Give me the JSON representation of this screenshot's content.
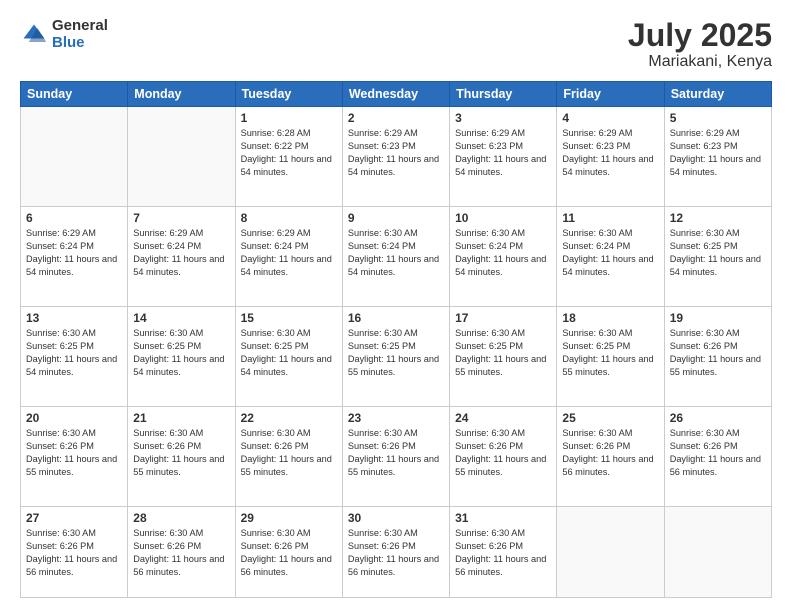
{
  "logo": {
    "general": "General",
    "blue": "Blue"
  },
  "title": {
    "month": "July 2025",
    "location": "Mariakani, Kenya"
  },
  "days_of_week": [
    "Sunday",
    "Monday",
    "Tuesday",
    "Wednesday",
    "Thursday",
    "Friday",
    "Saturday"
  ],
  "weeks": [
    [
      {
        "day": "",
        "info": ""
      },
      {
        "day": "",
        "info": ""
      },
      {
        "day": "1",
        "info": "Sunrise: 6:28 AM\nSunset: 6:22 PM\nDaylight: 11 hours and 54 minutes."
      },
      {
        "day": "2",
        "info": "Sunrise: 6:29 AM\nSunset: 6:23 PM\nDaylight: 11 hours and 54 minutes."
      },
      {
        "day": "3",
        "info": "Sunrise: 6:29 AM\nSunset: 6:23 PM\nDaylight: 11 hours and 54 minutes."
      },
      {
        "day": "4",
        "info": "Sunrise: 6:29 AM\nSunset: 6:23 PM\nDaylight: 11 hours and 54 minutes."
      },
      {
        "day": "5",
        "info": "Sunrise: 6:29 AM\nSunset: 6:23 PM\nDaylight: 11 hours and 54 minutes."
      }
    ],
    [
      {
        "day": "6",
        "info": "Sunrise: 6:29 AM\nSunset: 6:24 PM\nDaylight: 11 hours and 54 minutes."
      },
      {
        "day": "7",
        "info": "Sunrise: 6:29 AM\nSunset: 6:24 PM\nDaylight: 11 hours and 54 minutes."
      },
      {
        "day": "8",
        "info": "Sunrise: 6:29 AM\nSunset: 6:24 PM\nDaylight: 11 hours and 54 minutes."
      },
      {
        "day": "9",
        "info": "Sunrise: 6:30 AM\nSunset: 6:24 PM\nDaylight: 11 hours and 54 minutes."
      },
      {
        "day": "10",
        "info": "Sunrise: 6:30 AM\nSunset: 6:24 PM\nDaylight: 11 hours and 54 minutes."
      },
      {
        "day": "11",
        "info": "Sunrise: 6:30 AM\nSunset: 6:24 PM\nDaylight: 11 hours and 54 minutes."
      },
      {
        "day": "12",
        "info": "Sunrise: 6:30 AM\nSunset: 6:25 PM\nDaylight: 11 hours and 54 minutes."
      }
    ],
    [
      {
        "day": "13",
        "info": "Sunrise: 6:30 AM\nSunset: 6:25 PM\nDaylight: 11 hours and 54 minutes."
      },
      {
        "day": "14",
        "info": "Sunrise: 6:30 AM\nSunset: 6:25 PM\nDaylight: 11 hours and 54 minutes."
      },
      {
        "day": "15",
        "info": "Sunrise: 6:30 AM\nSunset: 6:25 PM\nDaylight: 11 hours and 54 minutes."
      },
      {
        "day": "16",
        "info": "Sunrise: 6:30 AM\nSunset: 6:25 PM\nDaylight: 11 hours and 55 minutes."
      },
      {
        "day": "17",
        "info": "Sunrise: 6:30 AM\nSunset: 6:25 PM\nDaylight: 11 hours and 55 minutes."
      },
      {
        "day": "18",
        "info": "Sunrise: 6:30 AM\nSunset: 6:25 PM\nDaylight: 11 hours and 55 minutes."
      },
      {
        "day": "19",
        "info": "Sunrise: 6:30 AM\nSunset: 6:26 PM\nDaylight: 11 hours and 55 minutes."
      }
    ],
    [
      {
        "day": "20",
        "info": "Sunrise: 6:30 AM\nSunset: 6:26 PM\nDaylight: 11 hours and 55 minutes."
      },
      {
        "day": "21",
        "info": "Sunrise: 6:30 AM\nSunset: 6:26 PM\nDaylight: 11 hours and 55 minutes."
      },
      {
        "day": "22",
        "info": "Sunrise: 6:30 AM\nSunset: 6:26 PM\nDaylight: 11 hours and 55 minutes."
      },
      {
        "day": "23",
        "info": "Sunrise: 6:30 AM\nSunset: 6:26 PM\nDaylight: 11 hours and 55 minutes."
      },
      {
        "day": "24",
        "info": "Sunrise: 6:30 AM\nSunset: 6:26 PM\nDaylight: 11 hours and 55 minutes."
      },
      {
        "day": "25",
        "info": "Sunrise: 6:30 AM\nSunset: 6:26 PM\nDaylight: 11 hours and 56 minutes."
      },
      {
        "day": "26",
        "info": "Sunrise: 6:30 AM\nSunset: 6:26 PM\nDaylight: 11 hours and 56 minutes."
      }
    ],
    [
      {
        "day": "27",
        "info": "Sunrise: 6:30 AM\nSunset: 6:26 PM\nDaylight: 11 hours and 56 minutes."
      },
      {
        "day": "28",
        "info": "Sunrise: 6:30 AM\nSunset: 6:26 PM\nDaylight: 11 hours and 56 minutes."
      },
      {
        "day": "29",
        "info": "Sunrise: 6:30 AM\nSunset: 6:26 PM\nDaylight: 11 hours and 56 minutes."
      },
      {
        "day": "30",
        "info": "Sunrise: 6:30 AM\nSunset: 6:26 PM\nDaylight: 11 hours and 56 minutes."
      },
      {
        "day": "31",
        "info": "Sunrise: 6:30 AM\nSunset: 6:26 PM\nDaylight: 11 hours and 56 minutes."
      },
      {
        "day": "",
        "info": ""
      },
      {
        "day": "",
        "info": ""
      }
    ]
  ]
}
